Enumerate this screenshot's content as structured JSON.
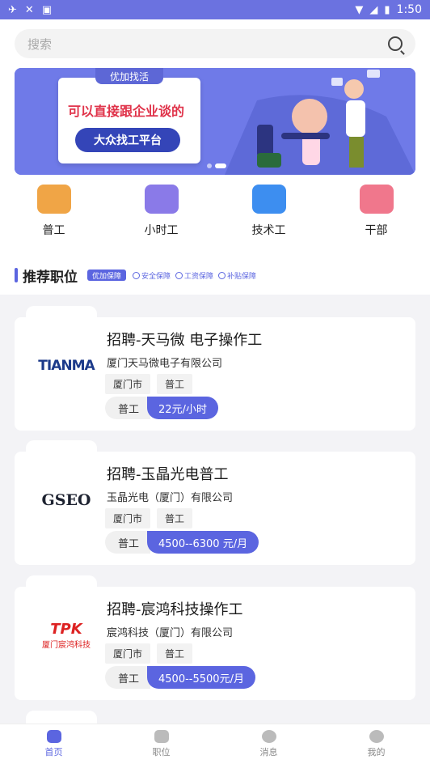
{
  "status_bar": {
    "time": "1:50",
    "icons_left": [
      "airplane-icon",
      "close-icon",
      "notification-icon"
    ],
    "icons_right": [
      "wifi-icon",
      "signal-icon",
      "battery-icon"
    ]
  },
  "search": {
    "placeholder": "搜索"
  },
  "banner": {
    "tag": "优加找活",
    "headline": "可以直接跟企业谈的",
    "button": "大众找工平台"
  },
  "categories": [
    {
      "label": "普工",
      "icon": "money-bag-icon",
      "color": "#f0a546"
    },
    {
      "label": "小时工",
      "icon": "lightning-icon",
      "color": "#8a7ae8"
    },
    {
      "label": "技术工",
      "icon": "phone-dollar-icon",
      "color": "#3d8ef0"
    },
    {
      "label": "干部",
      "icon": "briefcase-icon",
      "color": "#f0778c"
    }
  ],
  "recommend": {
    "title": "推荐职位",
    "badge": "优加保障",
    "guarantees": [
      "安全保障",
      "工资保障",
      "补贴保障"
    ]
  },
  "jobs": [
    {
      "title": "招聘-天马微 电子操作工",
      "company": "厦门天马微电子有限公司",
      "tags": [
        "厦门市",
        "普工"
      ],
      "type": "普工",
      "pay": "22元/小时",
      "logo": "TIANMA"
    },
    {
      "title": "招聘-玉晶光电普工",
      "company": "玉晶光电（厦门）有限公司",
      "tags": [
        "厦门市",
        "普工"
      ],
      "type": "普工",
      "pay": "4500--6300 元/月",
      "logo": "GSEO"
    },
    {
      "title": "招聘-宸鸿科技操作工",
      "company": "宸鸿科技（厦门）有限公司",
      "tags": [
        "厦门市",
        "普工"
      ],
      "type": "普工",
      "pay": "4500--5500元/月",
      "logo": "TPK",
      "logo_sub": "厦门宸鸿科技"
    }
  ],
  "nav": [
    {
      "label": "首页",
      "icon": "home-icon",
      "active": true
    },
    {
      "label": "职位",
      "icon": "briefcase-icon",
      "active": false
    },
    {
      "label": "消息",
      "icon": "message-icon",
      "active": false
    },
    {
      "label": "我的",
      "icon": "profile-icon",
      "active": false
    }
  ]
}
